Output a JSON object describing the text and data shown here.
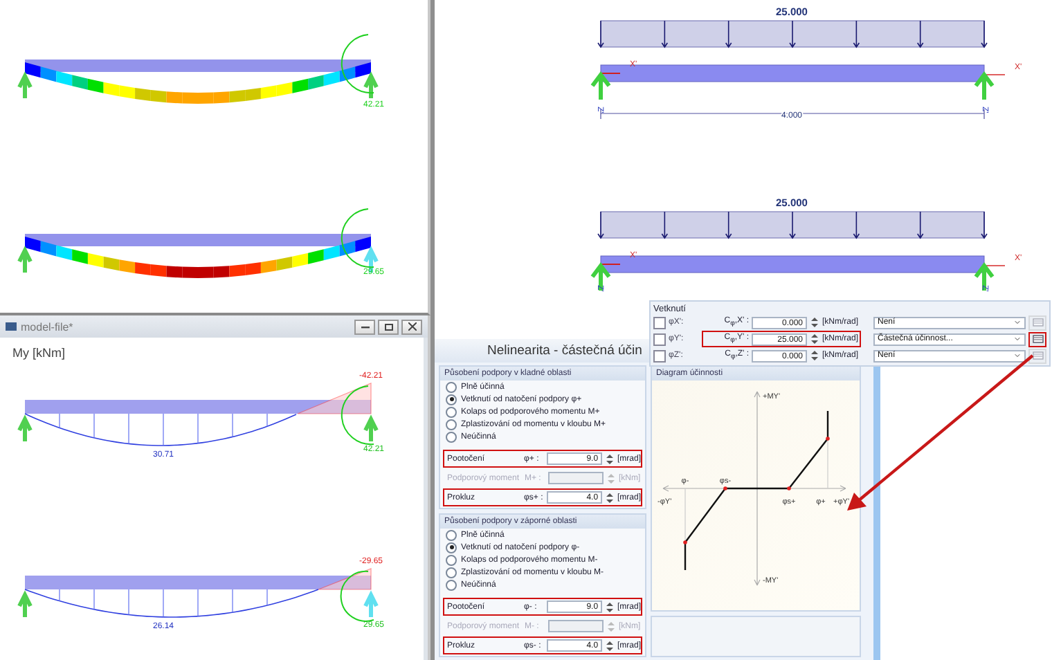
{
  "deformation_views": [
    {
      "moment": "42.21"
    },
    {
      "moment": "29.65"
    }
  ],
  "moment_window": {
    "title": "model-file*",
    "heading": "My [kNm]",
    "diagrams": [
      {
        "support_moment": "-42.21",
        "field_moment": "30.71",
        "reaction": "42.21"
      },
      {
        "support_moment": "-29.65",
        "field_moment": "26.14",
        "reaction": "29.65"
      }
    ]
  },
  "load_views": [
    {
      "load": "25.000",
      "axis_labels": [
        "X'",
        "Z'",
        "X'",
        "Z'"
      ],
      "span": "4.000"
    },
    {
      "load": "25.000",
      "axis_labels": [
        "X'",
        "Z'",
        "X'",
        "Z'"
      ]
    }
  ],
  "restraint_panel": {
    "title": "Vetknutí",
    "rows": [
      {
        "checked": false,
        "axis": "φX':",
        "label": "C$_{φ}$,X' :",
        "value": "0.000",
        "unit": "[kNm/rad]",
        "option": "Není",
        "highlighted": false,
        "button_disabled": true
      },
      {
        "checked": false,
        "axis": "φY':",
        "label": "C$_{φ}$,Y' :",
        "value": "25.000",
        "unit": "[kNm/rad]",
        "option": "Částečná účinnost...",
        "highlighted": true,
        "button_disabled": false
      },
      {
        "checked": false,
        "axis": "φZ':",
        "label": "C$_{φ}$,Z' :",
        "value": "0.000",
        "unit": "[kNm/rad]",
        "option": "Není",
        "highlighted": false,
        "button_disabled": true
      }
    ]
  },
  "dialog": {
    "title": "Nelinearita - částečná účin",
    "groups": [
      {
        "title": "Působení podpory v kladné oblasti",
        "options": [
          {
            "label": "Plně účinná",
            "selected": false
          },
          {
            "label": "Vetknutí od natočení podpory φ+",
            "selected": true
          },
          {
            "label": "Kolaps od podporového momentu M+",
            "selected": false
          },
          {
            "label": "Zplastizování od momentu v kloubu M+",
            "selected": false
          },
          {
            "label": "Neúčinná",
            "selected": false
          }
        ],
        "fields": [
          {
            "label": "Pootočení",
            "symbol": "φ+ :",
            "value": "9.0",
            "unit": "[mrad]",
            "disabled": false,
            "highlighted": true
          },
          {
            "label": "Podporový moment",
            "symbol": "M+ :",
            "unit": "[kNm]",
            "disabled": true,
            "highlighted": false
          },
          {
            "label": "Prokluz",
            "symbol": "φs+ :",
            "value": "4.0",
            "unit": "[mrad]",
            "disabled": false,
            "highlighted": true
          }
        ]
      },
      {
        "title": "Působení podpory v záporné oblasti",
        "options": [
          {
            "label": "Plně účinná",
            "selected": false
          },
          {
            "label": "Vetknutí od natočení podpory φ-",
            "selected": true
          },
          {
            "label": "Kolaps od podporového momentu M-",
            "selected": false
          },
          {
            "label": "Zplastizování od momentu v kloubu M-",
            "selected": false
          },
          {
            "label": "Neúčinná",
            "selected": false
          }
        ],
        "fields": [
          {
            "label": "Pootočení",
            "symbol": "φ- :",
            "value": "9.0",
            "unit": "[mrad]",
            "disabled": false,
            "highlighted": true
          },
          {
            "label": "Podporový moment",
            "symbol": "M- :",
            "unit": "[kNm]",
            "disabled": true,
            "highlighted": false
          },
          {
            "label": "Prokluz",
            "symbol": "φs- :",
            "value": "4.0",
            "unit": "[mrad]",
            "disabled": false,
            "highlighted": true
          }
        ]
      }
    ],
    "diagram": {
      "title": "Diagram účinnosti",
      "labels": [
        "+MY'",
        "φ-",
        "φs-",
        "-φY'",
        "φs+",
        "φ+",
        "+φY'",
        "-MY'"
      ]
    }
  }
}
